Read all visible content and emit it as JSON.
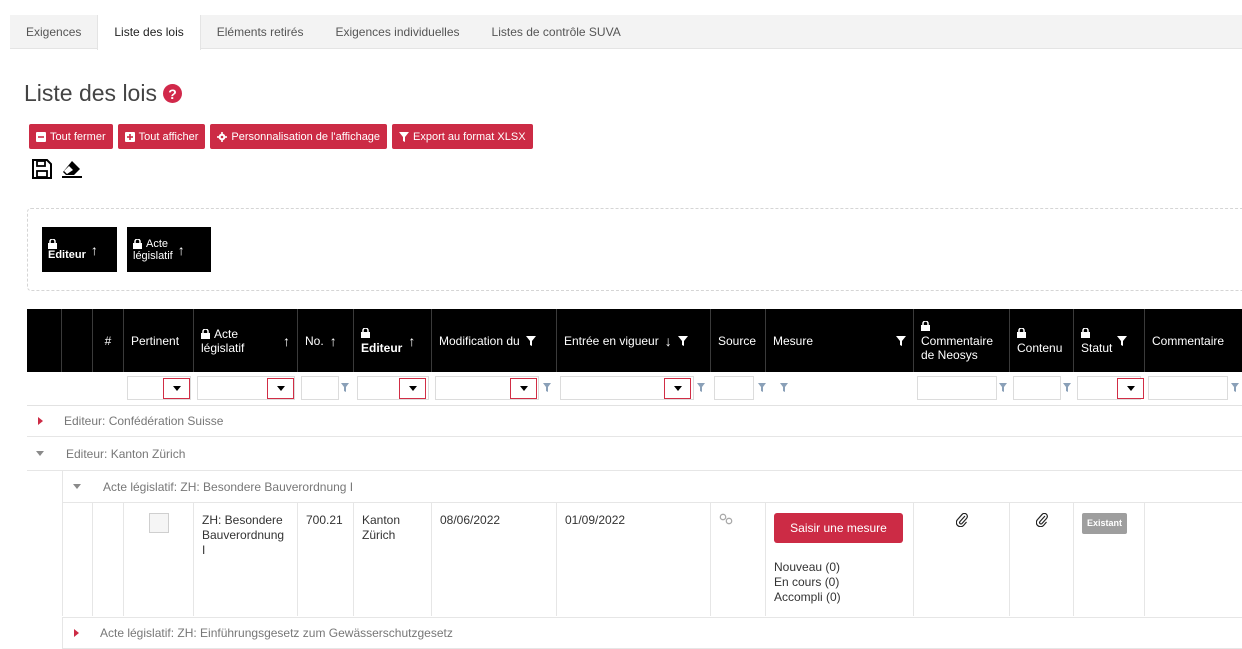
{
  "tabs": [
    "Exigences",
    "Liste des lois",
    "Eléments retirés",
    "Exigences individuelles",
    "Listes de contrôle SUVA"
  ],
  "page": {
    "title": "Liste des lois"
  },
  "toolbar": {
    "collapse_label": "Tout fermer",
    "expand_label": "Tout afficher",
    "customize_label": "Personnalisation de l'affichage",
    "export_label": "Export au format XLSX"
  },
  "group_chips": [
    {
      "line1": "",
      "line2": "Editeur"
    },
    {
      "line1": "Acte",
      "line2": "législatif"
    }
  ],
  "columns": {
    "hash": "#",
    "pertinent": "Pertinent",
    "acte_1": "Acte",
    "acte_2": "législatif",
    "no": "No.",
    "editeur": "Editeur",
    "modification": "Modification du",
    "entree": "Entrée en vigueur",
    "source": "Source",
    "mesure": "Mesure",
    "commentaire_neosys_1": "Commentaire",
    "commentaire_neosys_2": "de Neosys",
    "contenu": "Contenu",
    "statut": "Statut",
    "commentaire": "Commentaire"
  },
  "groups": {
    "g1": "Editeur: Confédération Suisse",
    "g2": "Editeur: Kanton Zürich",
    "g2a": "Acte législatif: ZH: Besondere Bauverordnung I",
    "g2b": "Acte législatif: ZH: Einführungsgesetz zum Gewässerschutzgesetz"
  },
  "row": {
    "acte_1": "ZH: Besondere",
    "acte_2": "Bauverordnung",
    "acte_3": "I",
    "no": "700.21",
    "editeur_1": "Kanton",
    "editeur_2": "Zürich",
    "modification": "08/06/2022",
    "entree": "01/09/2022",
    "button": "Saisir une mesure",
    "nouveau": "Nouveau (0)",
    "en_cours": "En cours (0)",
    "accompli": "Accompli (0)",
    "statut": "Existant"
  },
  "colors": {
    "accent": "#cc2b45",
    "header_bg": "#000000",
    "badge": "#9e9e9e"
  }
}
